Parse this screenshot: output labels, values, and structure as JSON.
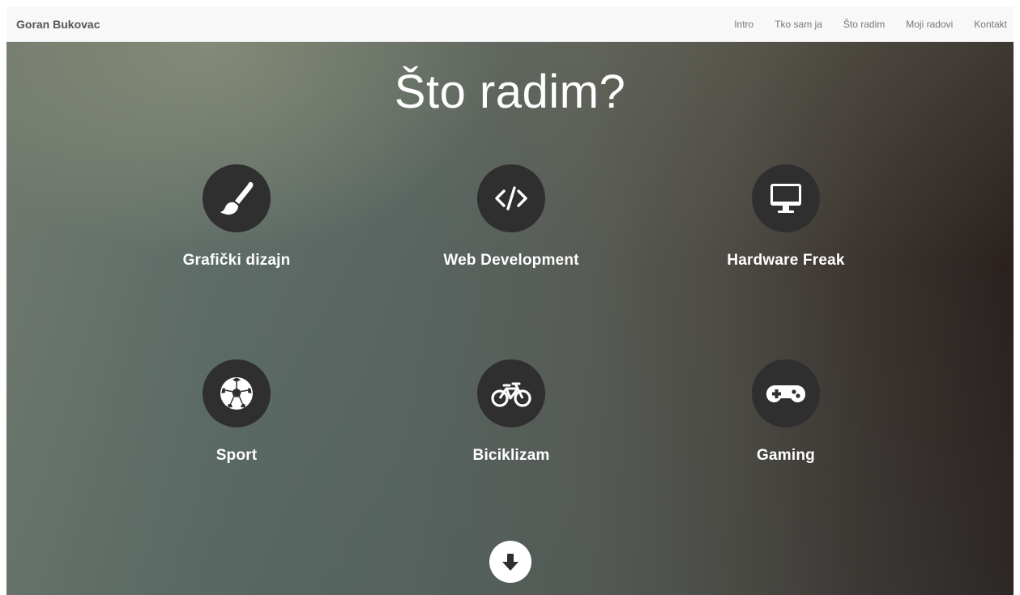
{
  "navbar": {
    "brand": "Goran Bukovac",
    "links": [
      "Intro",
      "Tko sam ja",
      "Što radim",
      "Moji radovi",
      "Kontakt"
    ]
  },
  "section": {
    "title": "Što radim?",
    "services": [
      {
        "label": "Grafički dizajn",
        "icon": "paintbrush-icon"
      },
      {
        "label": "Web Development",
        "icon": "code-icon"
      },
      {
        "label": "Hardware Freak",
        "icon": "desktop-icon"
      },
      {
        "label": "Sport",
        "icon": "soccer-ball-icon"
      },
      {
        "label": "Biciklizam",
        "icon": "bicycle-icon"
      },
      {
        "label": "Gaming",
        "icon": "gamepad-icon"
      }
    ]
  },
  "colors": {
    "icon_bg": "#2f2f2f",
    "nav_bg": "#f8f8f8",
    "text_light": "#ffffff"
  }
}
